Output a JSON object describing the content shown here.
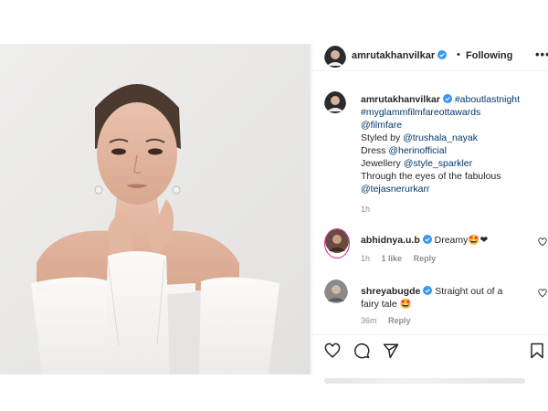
{
  "post": {
    "author": {
      "username": "amrutakhanvilkar",
      "verified": true
    },
    "follow_status": "Following",
    "separator": "•",
    "more_label": "•••",
    "caption": {
      "username": "amrutakhanvilkar",
      "lines": [
        {
          "text": "#aboutlastnight",
          "style": "link"
        },
        {
          "text": "#myglammfilmfareottawards",
          "style": "link"
        },
        {
          "text": "@filmfare",
          "style": "link"
        },
        {
          "prefix": "Styled by ",
          "mention": "@trushala_nayak"
        },
        {
          "prefix": "Dress ",
          "mention": "@herinofficial"
        },
        {
          "prefix": "Jewellery ",
          "mention": "@style_sparkler"
        },
        {
          "text": "Through the eyes of the fabulous",
          "style": "plain"
        },
        {
          "text": "@tejasnerurkarr",
          "style": "link"
        }
      ],
      "time": "1h"
    },
    "comments": [
      {
        "username": "abhidnya.u.b",
        "verified": true,
        "text": "Dreamy",
        "emoji": "🤩❤",
        "time": "1h",
        "likes": "1 like",
        "reply": "Reply"
      },
      {
        "username": "shreyabugde",
        "verified": true,
        "text": "Straight out of a",
        "text2": "fairy tale",
        "emoji": "🤩",
        "time": "36m",
        "reply": "Reply"
      }
    ]
  },
  "icons": {
    "like": "heart-icon",
    "comment": "comment-icon",
    "share": "paper-plane-icon",
    "save": "bookmark-icon",
    "verified": "verified-badge-icon",
    "more": "more-options-icon"
  },
  "colors": {
    "link": "#00376b",
    "verified": "#3897f0",
    "text": "#262626",
    "muted": "#8e8e8e"
  }
}
